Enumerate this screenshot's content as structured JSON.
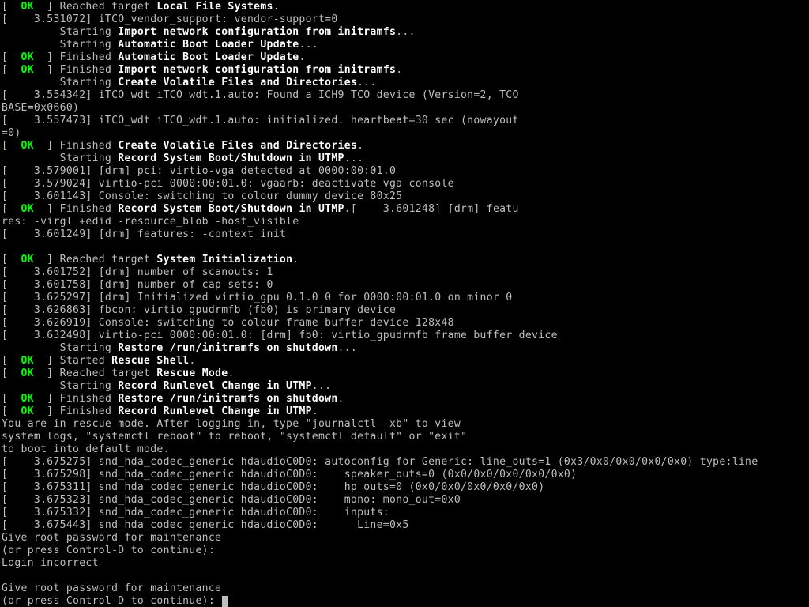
{
  "ok_token": "  OK  ",
  "lines": [
    {
      "segments": [
        {
          "t": "["
        },
        {
          "style": "ok",
          "bind": "ok_token"
        },
        {
          "t": "] Reached target "
        },
        {
          "style": "b",
          "t": "Local File Systems"
        },
        {
          "t": "."
        }
      ]
    },
    {
      "segments": [
        {
          "t": "[    3.531072] iTCO_vendor_support: vendor-support=0"
        }
      ]
    },
    {
      "segments": [
        {
          "t": "         Starting "
        },
        {
          "style": "b",
          "t": "Import network configuration from initramfs"
        },
        {
          "t": "..."
        }
      ]
    },
    {
      "segments": [
        {
          "t": "         Starting "
        },
        {
          "style": "b",
          "t": "Automatic Boot Loader Update"
        },
        {
          "t": "..."
        }
      ]
    },
    {
      "segments": [
        {
          "t": "["
        },
        {
          "style": "ok",
          "bind": "ok_token"
        },
        {
          "t": "] Finished "
        },
        {
          "style": "b",
          "t": "Automatic Boot Loader Update"
        },
        {
          "t": "."
        }
      ]
    },
    {
      "segments": [
        {
          "t": "["
        },
        {
          "style": "ok",
          "bind": "ok_token"
        },
        {
          "t": "] Finished "
        },
        {
          "style": "b",
          "t": "Import network configuration from initramfs"
        },
        {
          "t": "."
        }
      ]
    },
    {
      "segments": [
        {
          "t": "         Starting "
        },
        {
          "style": "b",
          "t": "Create Volatile Files and Directories"
        },
        {
          "t": "..."
        }
      ]
    },
    {
      "segments": [
        {
          "t": "[    3.554342] iTCO_wdt iTCO_wdt.1.auto: Found a ICH9 TCO device (Version=2, TCO"
        }
      ]
    },
    {
      "segments": [
        {
          "t": "BASE=0x0660)"
        }
      ]
    },
    {
      "segments": [
        {
          "t": "[    3.557473] iTCO_wdt iTCO_wdt.1.auto: initialized. heartbeat=30 sec (nowayout"
        }
      ]
    },
    {
      "segments": [
        {
          "t": "=0)"
        }
      ]
    },
    {
      "segments": [
        {
          "t": "["
        },
        {
          "style": "ok",
          "bind": "ok_token"
        },
        {
          "t": "] Finished "
        },
        {
          "style": "b",
          "t": "Create Volatile Files and Directories"
        },
        {
          "t": "."
        }
      ]
    },
    {
      "segments": [
        {
          "t": "         Starting "
        },
        {
          "style": "b",
          "t": "Record System Boot/Shutdown in UTMP"
        },
        {
          "t": "..."
        }
      ]
    },
    {
      "segments": [
        {
          "t": "[    3.579001] [drm] pci: virtio-vga detected at 0000:00:01.0"
        }
      ]
    },
    {
      "segments": [
        {
          "t": "[    3.579024] virtio-pci 0000:00:01.0: vgaarb: deactivate vga console"
        }
      ]
    },
    {
      "segments": [
        {
          "t": "[    3.601143] Console: switching to colour dummy device 80x25"
        }
      ]
    },
    {
      "segments": [
        {
          "t": "["
        },
        {
          "style": "ok",
          "bind": "ok_token"
        },
        {
          "t": "] Finished "
        },
        {
          "style": "b",
          "t": "Record System Boot/Shutdown in UTMP"
        },
        {
          "t": ".[    3.601248] [drm] featu"
        }
      ]
    },
    {
      "segments": [
        {
          "t": "res: -virgl +edid -resource_blob -host_visible"
        }
      ]
    },
    {
      "segments": [
        {
          "t": "[    3.601249] [drm] features: -context_init"
        }
      ]
    },
    {
      "segments": [
        {
          "t": " "
        }
      ]
    },
    {
      "segments": [
        {
          "t": "["
        },
        {
          "style": "ok",
          "bind": "ok_token"
        },
        {
          "t": "] Reached target "
        },
        {
          "style": "b",
          "t": "System Initialization"
        },
        {
          "t": "."
        }
      ]
    },
    {
      "segments": [
        {
          "t": "[    3.601752] [drm] number of scanouts: 1"
        }
      ]
    },
    {
      "segments": [
        {
          "t": "[    3.601758] [drm] number of cap sets: 0"
        }
      ]
    },
    {
      "segments": [
        {
          "t": "[    3.625297] [drm] Initialized virtio_gpu 0.1.0 0 for 0000:00:01.0 on minor 0"
        }
      ]
    },
    {
      "segments": [
        {
          "t": "[    3.626863] fbcon: virtio_gpudrmfb (fb0) is primary device"
        }
      ]
    },
    {
      "segments": [
        {
          "t": "[    3.626919] Console: switching to colour frame buffer device 128x48"
        }
      ]
    },
    {
      "segments": [
        {
          "t": "[    3.632498] virtio-pci 0000:00:01.0: [drm] fb0: virtio_gpudrmfb frame buffer device"
        }
      ]
    },
    {
      "segments": [
        {
          "t": "         Starting "
        },
        {
          "style": "b",
          "t": "Restore /run/initramfs on shutdown"
        },
        {
          "t": "..."
        }
      ]
    },
    {
      "segments": [
        {
          "t": "["
        },
        {
          "style": "ok",
          "bind": "ok_token"
        },
        {
          "t": "] Started "
        },
        {
          "style": "b",
          "t": "Rescue Shell"
        },
        {
          "t": "."
        }
      ]
    },
    {
      "segments": [
        {
          "t": "["
        },
        {
          "style": "ok",
          "bind": "ok_token"
        },
        {
          "t": "] Reached target "
        },
        {
          "style": "b",
          "t": "Rescue Mode"
        },
        {
          "t": "."
        }
      ]
    },
    {
      "segments": [
        {
          "t": "         Starting "
        },
        {
          "style": "b",
          "t": "Record Runlevel Change in UTMP"
        },
        {
          "t": "..."
        }
      ]
    },
    {
      "segments": [
        {
          "t": "["
        },
        {
          "style": "ok",
          "bind": "ok_token"
        },
        {
          "t": "] Finished "
        },
        {
          "style": "b",
          "t": "Restore /run/initramfs on shutdown"
        },
        {
          "t": "."
        }
      ]
    },
    {
      "segments": [
        {
          "t": "["
        },
        {
          "style": "ok",
          "bind": "ok_token"
        },
        {
          "t": "] Finished "
        },
        {
          "style": "b",
          "t": "Record Runlevel Change in UTMP"
        },
        {
          "t": "."
        }
      ]
    },
    {
      "segments": [
        {
          "t": "You are in rescue mode. After logging in, type \"journalctl -xb\" to view"
        }
      ]
    },
    {
      "segments": [
        {
          "t": "system logs, \"systemctl reboot\" to reboot, \"systemctl default\" or \"exit\""
        }
      ]
    },
    {
      "segments": [
        {
          "t": "to boot into default mode."
        }
      ]
    },
    {
      "segments": [
        {
          "t": "[    3.675275] snd_hda_codec_generic hdaudioC0D0: autoconfig for Generic: line_outs=1 (0x3/0x0/0x0/0x0/0x0) type:line"
        }
      ]
    },
    {
      "segments": [
        {
          "t": "[    3.675298] snd_hda_codec_generic hdaudioC0D0:    speaker_outs=0 (0x0/0x0/0x0/0x0/0x0)"
        }
      ]
    },
    {
      "segments": [
        {
          "t": "[    3.675311] snd_hda_codec_generic hdaudioC0D0:    hp_outs=0 (0x0/0x0/0x0/0x0/0x0)"
        }
      ]
    },
    {
      "segments": [
        {
          "t": "[    3.675323] snd_hda_codec_generic hdaudioC0D0:    mono: mono_out=0x0"
        }
      ]
    },
    {
      "segments": [
        {
          "t": "[    3.675332] snd_hda_codec_generic hdaudioC0D0:    inputs:"
        }
      ]
    },
    {
      "segments": [
        {
          "t": "[    3.675443] snd_hda_codec_generic hdaudioC0D0:      Line=0x5"
        }
      ]
    },
    {
      "segments": [
        {
          "t": "Give root password for maintenance"
        }
      ]
    },
    {
      "segments": [
        {
          "t": "(or press Control-D to continue): "
        }
      ]
    },
    {
      "segments": [
        {
          "t": "Login incorrect"
        }
      ]
    },
    {
      "segments": [
        {
          "t": " "
        }
      ]
    },
    {
      "segments": [
        {
          "t": "Give root password for maintenance"
        }
      ]
    },
    {
      "segments": [
        {
          "t": "(or press Control-D to continue): "
        }
      ],
      "cursor": true
    }
  ]
}
